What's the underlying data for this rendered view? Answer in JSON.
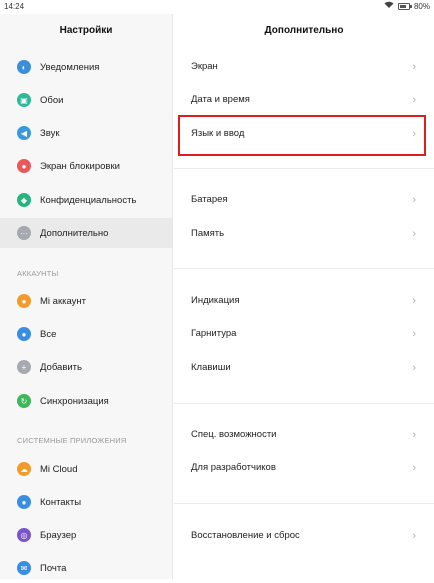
{
  "status": {
    "time": "14:24",
    "battery": "80%",
    "battery_level": 0.8
  },
  "left": {
    "title": "Настройки",
    "items": [
      {
        "label": "Уведомления",
        "icon": "notifications-icon",
        "color": "#3b8fd8"
      },
      {
        "label": "Обои",
        "icon": "wallpaper-icon",
        "color": "#2fb89a"
      },
      {
        "label": "Звук",
        "icon": "sound-icon",
        "color": "#3a9ad9"
      },
      {
        "label": "Экран блокировки",
        "icon": "lock-screen-icon",
        "color": "#e85a5a"
      },
      {
        "label": "Конфиденциальность",
        "icon": "privacy-icon",
        "color": "#26b57f"
      },
      {
        "label": "Дополнительно",
        "icon": "more-icon",
        "color": "#a6aab0"
      }
    ],
    "section_accounts": "АККАУНТЫ",
    "accounts": [
      {
        "label": "Mi аккаунт",
        "icon": "mi-account-icon",
        "color": "#f39a2d"
      },
      {
        "label": "Все",
        "icon": "all-accounts-icon",
        "color": "#3a8ee0"
      },
      {
        "label": "Добавить",
        "icon": "add-account-icon",
        "color": "#a6aab0"
      },
      {
        "label": "Синхронизация",
        "icon": "sync-icon",
        "color": "#3fb65a"
      }
    ],
    "section_system": "СИСТЕМНЫЕ ПРИЛОЖЕНИЯ",
    "system": [
      {
        "label": "Mi Cloud",
        "icon": "cloud-icon",
        "color": "#f39a2d"
      },
      {
        "label": "Контакты",
        "icon": "contacts-icon",
        "color": "#3a8ee0"
      },
      {
        "label": "Браузер",
        "icon": "browser-icon",
        "color": "#7a55c9"
      },
      {
        "label": "Почта",
        "icon": "mail-icon",
        "color": "#3a8ee0"
      }
    ]
  },
  "right": {
    "title": "Дополнительно",
    "items": [
      {
        "label": "Экран"
      },
      {
        "label": "Дата и время"
      },
      {
        "label": "Язык и ввод"
      },
      {
        "label": "Батарея"
      },
      {
        "label": "Память"
      },
      {
        "label": "Индикация"
      },
      {
        "label": "Гарнитура"
      },
      {
        "label": "Клавиши"
      },
      {
        "label": "Спец. возможности"
      },
      {
        "label": "Для разработчиков"
      },
      {
        "label": "Восстановление и сброс"
      }
    ]
  },
  "colors": {
    "highlight": "#e01e1e",
    "chevron": "#b0b0b0"
  }
}
